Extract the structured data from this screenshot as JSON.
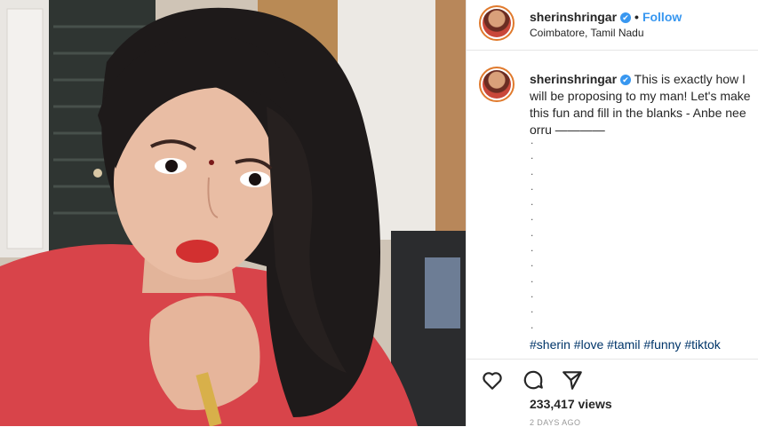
{
  "post": {
    "username": "sherinshringar",
    "verified_badge": "✔",
    "separator": "•",
    "follow_label": "Follow",
    "location": "Coimbatore, Tamil Nadu"
  },
  "caption": {
    "username": "sherinshringar",
    "text": "This is exactly how I will be proposing to my man! Let's make this fun and fill in the blanks - Anbe nee orru ————",
    "dots": [
      ".",
      ".",
      ".",
      ".",
      ".",
      ".",
      ".",
      ".",
      ".",
      ".",
      ".",
      ".",
      "."
    ],
    "hashtags": "#sherin #love #tamil #funny #tiktok"
  },
  "stats": {
    "views": "233,417 views",
    "date": "2 DAYS AGO"
  },
  "icons": {
    "like": "heart-icon",
    "comment": "comment-icon",
    "share": "share-icon"
  },
  "colors": {
    "link": "#3897f0",
    "hashtag": "#003569",
    "verified": "#3897f0",
    "avatar_ring": "#e07a2d"
  }
}
